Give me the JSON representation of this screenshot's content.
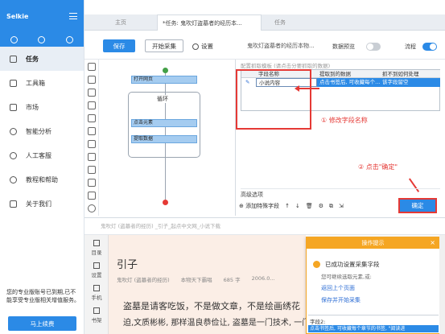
{
  "sidebar": {
    "brand": "Selkie",
    "items": [
      {
        "label": "任务"
      },
      {
        "label": "工具箱"
      },
      {
        "label": "市场"
      },
      {
        "label": "智能分析"
      },
      {
        "label": "人工客服"
      },
      {
        "label": "教程和帮助"
      },
      {
        "label": "关于我们"
      }
    ],
    "note": "您的专业版账号已到期,已不能享受专业版相关增值服务。",
    "upgrade_label": "马上续费"
  },
  "tabs": [
    {
      "label": "主页"
    },
    {
      "label": "*任务: 鬼吹灯盗墓者的经历本..."
    },
    {
      "label": "任务"
    }
  ],
  "toolbar": {
    "save_label": "保存",
    "start_label": "开始采集",
    "settings_label": "设置",
    "task_title": "鬼吹灯盗墓者的经历本物...",
    "preview_label": "数据预览",
    "flow_label": "流程"
  },
  "flow": {
    "open_page": "打开网页",
    "loop_label": "循环",
    "click_element": "点击元素",
    "extract_data": "提取数据"
  },
  "config": {
    "header": "配置抓取模板 (请点击分要抓取的数据)",
    "columns": [
      "字段名称",
      "提取到的数据",
      "抓不到如何处理"
    ],
    "row": {
      "name": "小说内容",
      "data": "点击书签后, 可收藏每个...",
      "fallback": "该字段留空"
    },
    "annotation1": "① 修改字段名称",
    "annotation2": "② 点击\"确定\"",
    "advanced_label": "高级选项",
    "add_field_label": "添加特殊字段",
    "ok_label": "确定"
  },
  "browser": {
    "url": "鬼吹灯 (盗墓者的经历) _引子_起点中文网_小说下载",
    "side_items": [
      "目录",
      "设置",
      "手机",
      "书架"
    ],
    "chapter": "引子",
    "meta": [
      "鬼吹灯 (盗墓者的经历)",
      "本物天下霸唱",
      "685 字",
      "2006.0..."
    ],
    "lines": [
      "盗墓是请客吃饭，不是做文章，不是绘画绣花",
      "迫,文质彬彬, 那样温良恭俭让, 盗墓是一门技术, 一门进"
    ]
  },
  "popup": {
    "title": "操作提示",
    "success": "已成功设置采集字段",
    "sub": "您可继续选取元素,或:",
    "link1": "返回上个页面",
    "link2": "保存并开始采集",
    "field_label": "字段2:",
    "field_value": "点击书签后, 可收藏每个章节的书签, \"阅读进"
  }
}
